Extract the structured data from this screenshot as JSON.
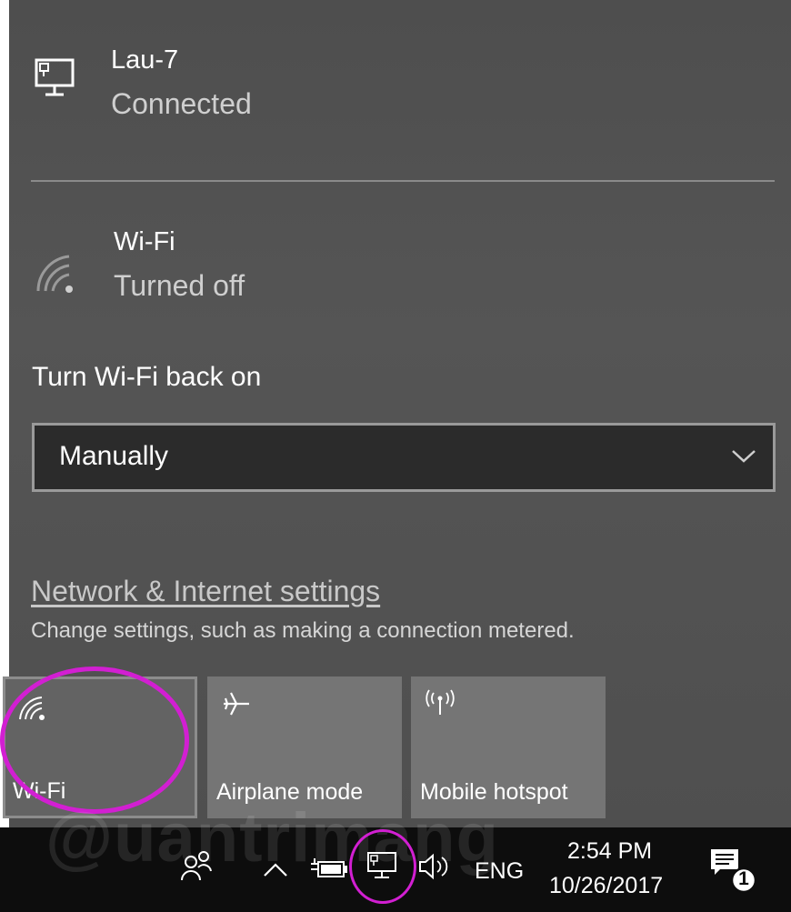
{
  "networks": [
    {
      "name": "Lau-7",
      "status": "Connected",
      "icon": "ethernet-monitor-icon"
    },
    {
      "name": "Wi-Fi",
      "status": "Turned off",
      "icon": "wifi-off-icon"
    }
  ],
  "wifi_back_on": {
    "label": "Turn Wi-Fi back on",
    "selected": "Manually",
    "chevron_icon": "chevron-down-icon"
  },
  "settings": {
    "link": "Network & Internet settings",
    "description": "Change settings, such as making a connection metered."
  },
  "quick_actions": [
    {
      "label": "Wi-Fi",
      "icon": "wifi-icon"
    },
    {
      "label": "Airplane mode",
      "icon": "airplane-icon"
    },
    {
      "label": "Mobile hotspot",
      "icon": "hotspot-icon"
    }
  ],
  "taskbar": {
    "time": "2:54 PM",
    "date": "10/26/2017",
    "language": "ENG",
    "notification_count": "1",
    "watermark": "@uantrimang"
  },
  "colors": {
    "flyout_bg": "#4f4f4f",
    "tile_bg": "#757575",
    "taskbar_bg": "#0d0d0d",
    "highlight": "#d21fd2"
  }
}
